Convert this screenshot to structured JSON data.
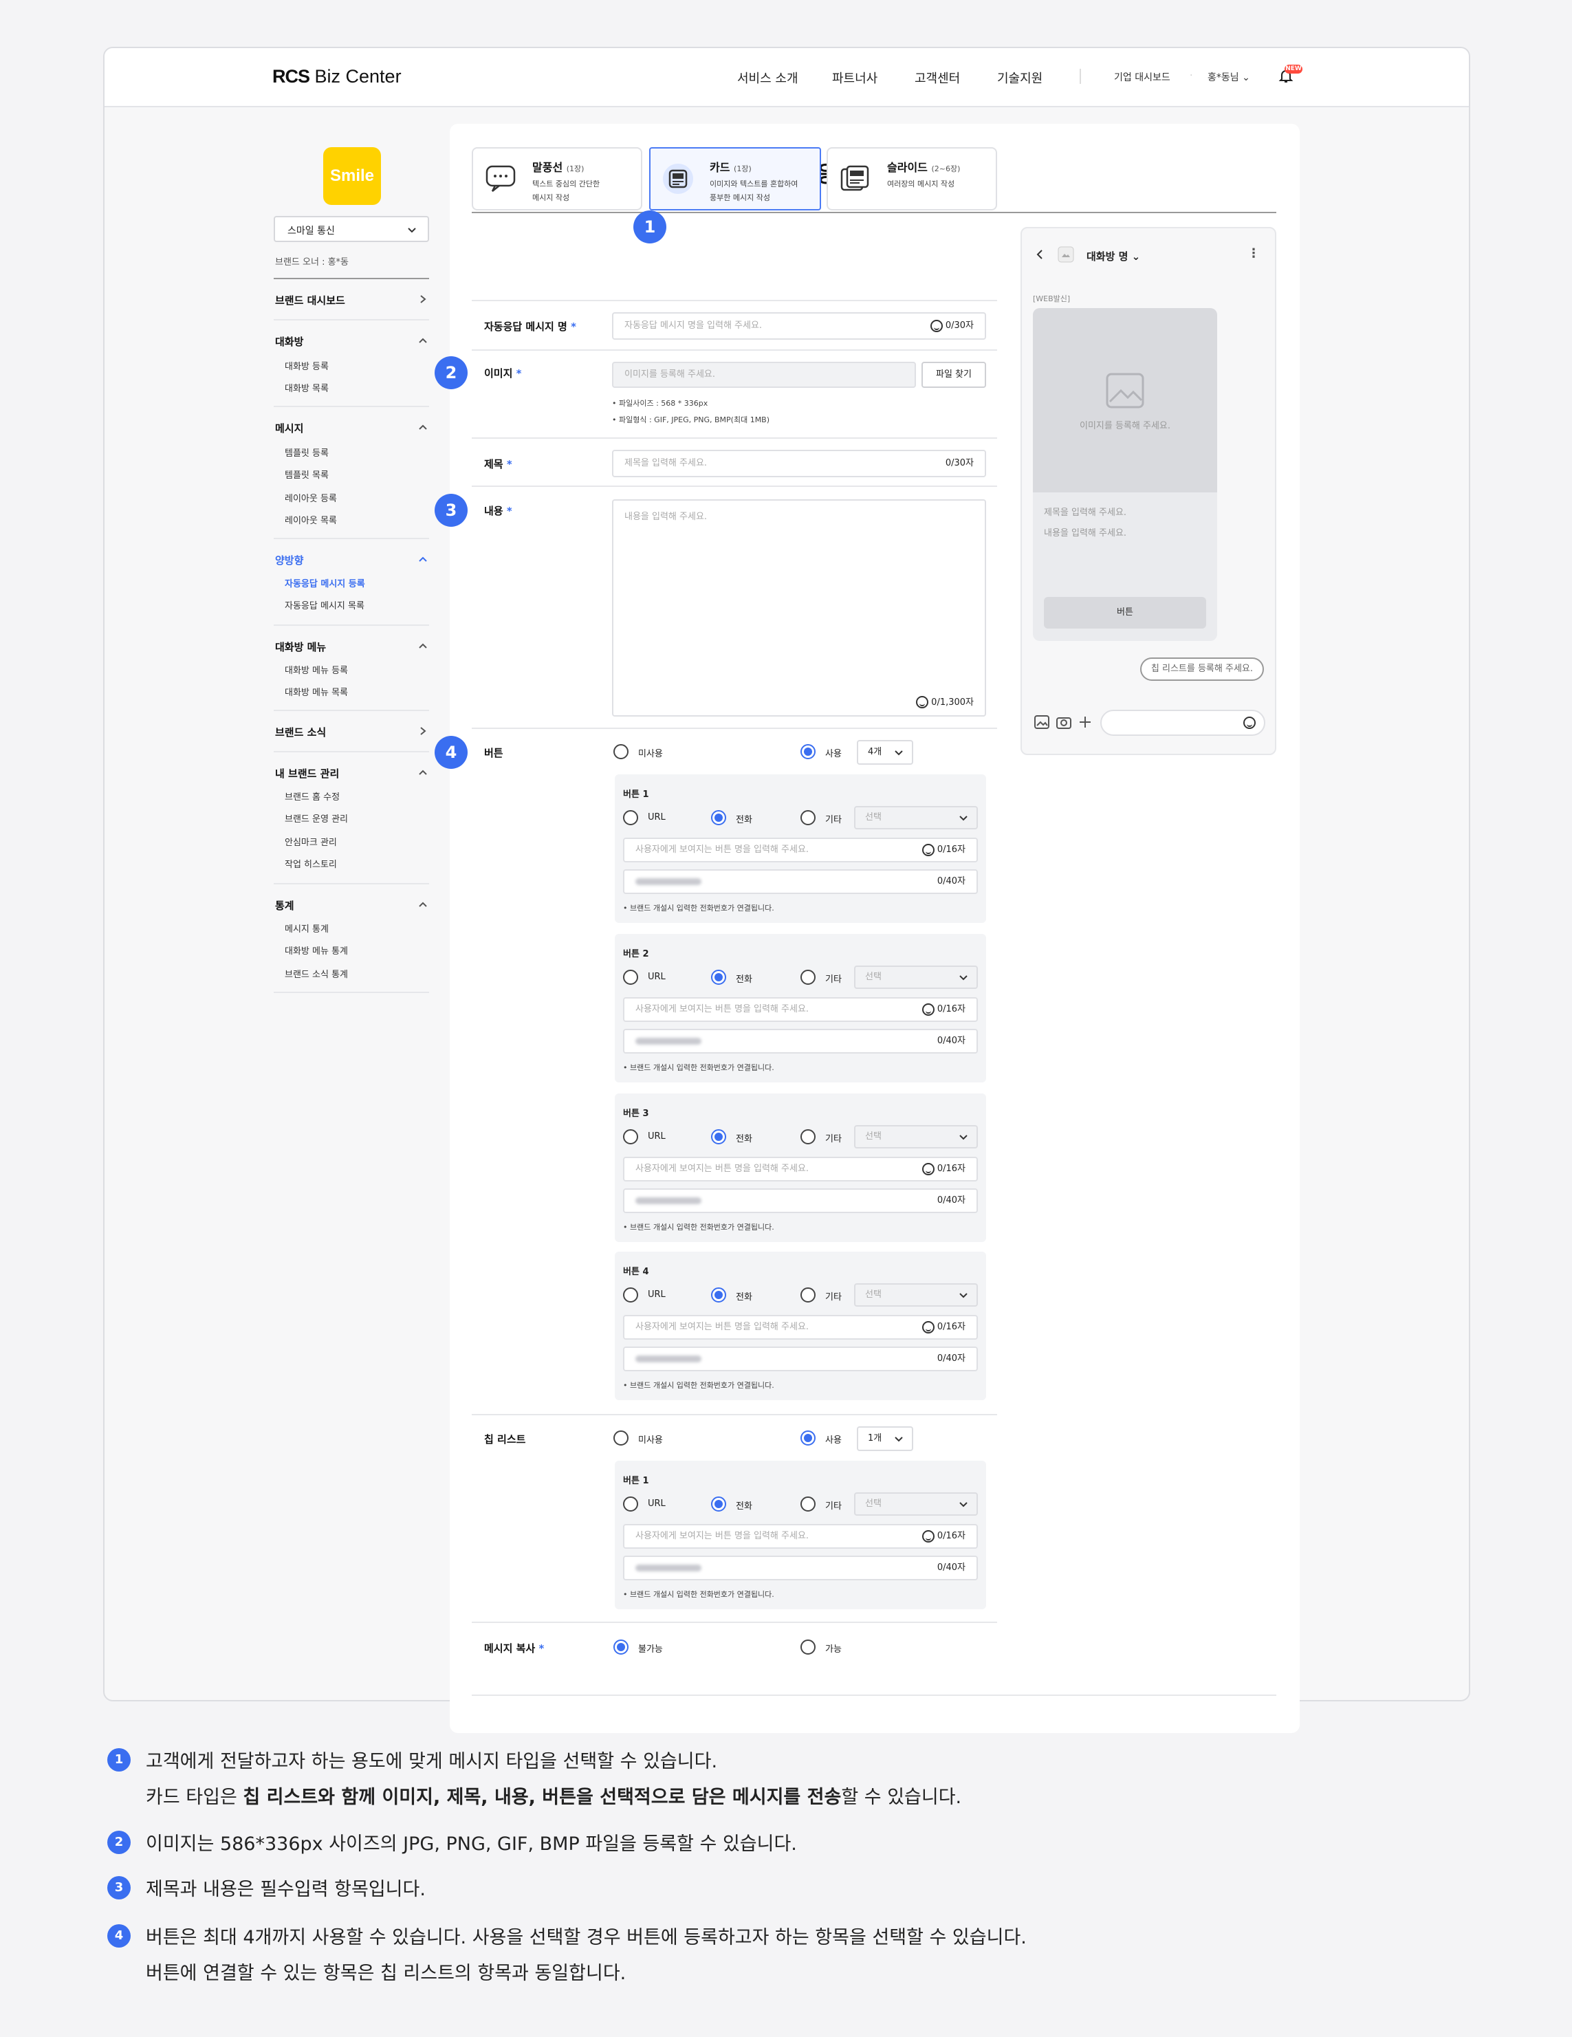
{
  "header": {
    "logo_bold": "RCS",
    "logo_rest": " Biz Center",
    "nav": [
      "서비스 소개",
      "파트너사",
      "고객센터",
      "기술지원"
    ],
    "util": {
      "dashboard": "기업 대시보드",
      "user": "홍*동님",
      "notif_badge": "NEW"
    }
  },
  "sidebar": {
    "brand_logo": "Smile",
    "brand_select": "스마일 통신",
    "owner": "브랜드 오너 : 홍*동",
    "dashboard": "브랜드 대시보드",
    "groups": [
      {
        "title": "대화방",
        "items": [
          "대화방 등록",
          "대화방 목록"
        ]
      },
      {
        "title": "메시지",
        "items": [
          "템플릿 등록",
          "템플릿 목록",
          "레이아웃 등록",
          "레이아웃 목록"
        ]
      },
      {
        "title": "양방향",
        "items": [
          "자동응답 메시지 등록",
          "자동응답 메시지 목록"
        ]
      },
      {
        "title": "대화방 메뉴",
        "items": [
          "대화방 메뉴 등록",
          "대화방 메뉴 목록"
        ]
      },
      {
        "title": "브랜드 소식",
        "items": []
      },
      {
        "title": "내 브랜드 관리",
        "items": [
          "브랜드 홈 수정",
          "브랜드 운영 관리",
          "안심마크 관리",
          "작업 히스토리"
        ]
      },
      {
        "title": "통계",
        "items": [
          "메시지 통계",
          "대화방 메뉴 통계",
          "브랜드 소식 통계"
        ]
      }
    ]
  },
  "page": {
    "title": "자동응답 메시지 등록"
  },
  "tabs": [
    {
      "name": "말풍선",
      "count": "(1장)",
      "desc1": "텍스트 중심의 간단한",
      "desc2": "메시지 작성",
      "icon": "speech-bubble-icon"
    },
    {
      "name": "카드",
      "count": "(1장)",
      "desc1": "이미지와 텍스트를 혼합하여",
      "desc2": "풍부한 메시지 작성",
      "icon": "card-icon"
    },
    {
      "name": "슬라이드",
      "count": "(2~6장)",
      "desc1": "여러장의 메시지 작성",
      "desc2": "",
      "icon": "slide-icon"
    }
  ],
  "form": {
    "name_label": "자동응답 메시지 명",
    "name_placeholder": "자동응답 메시지 명을 입력해 주세요.",
    "name_count": "0/30자",
    "image_label": "이미지",
    "image_placeholder": "이미지를 등록해 주세요.",
    "file_button": "파일 찾기",
    "image_note1": "파일사이즈 : 568 * 336px",
    "image_note2": "파일형식 : GIF, JPEG, PNG, BMP(최대 1MB)",
    "title_label": "제목",
    "title_placeholder": "제목을 입력해 주세요.",
    "title_count": "0/30자",
    "content_label": "내용",
    "content_placeholder": "내용을 입력해 주세요.",
    "content_count": "0/1,300자",
    "button_label": "버튼",
    "unused": "미사용",
    "used": "사용",
    "button_count": "4개",
    "buttons": [
      {
        "title": "버튼 1",
        "url": "URL",
        "phone": "전화",
        "etc": "기타",
        "select": "선택",
        "name_ph": "사용자에게 보여지는 버튼 명을 입력해 주세요.",
        "name_count": "0/16자",
        "phone_count": "0/40자",
        "note": "브랜드 개설시 입력한 전화번호가 연결됩니다."
      },
      {
        "title": "버튼 2",
        "url": "URL",
        "phone": "전화",
        "etc": "기타",
        "select": "선택",
        "name_ph": "사용자에게 보여지는 버튼 명을 입력해 주세요.",
        "name_count": "0/16자",
        "phone_count": "0/40자",
        "note": "브랜드 개설시 입력한 전화번호가 연결됩니다."
      },
      {
        "title": "버튼 3",
        "url": "URL",
        "phone": "전화",
        "etc": "기타",
        "select": "선택",
        "name_ph": "사용자에게 보여지는 버튼 명을 입력해 주세요.",
        "name_count": "0/16자",
        "phone_count": "0/40자",
        "note": "브랜드 개설시 입력한 전화번호가 연결됩니다."
      },
      {
        "title": "버튼 4",
        "url": "URL",
        "phone": "전화",
        "etc": "기타",
        "select": "선택",
        "name_ph": "사용자에게 보여지는 버튼 명을 입력해 주세요.",
        "name_count": "0/16자",
        "phone_count": "0/40자",
        "note": "브랜드 개설시 입력한 전화번호가 연결됩니다."
      }
    ],
    "chip_label": "칩 리스트",
    "chip_count": "1개",
    "chip_button": {
      "title": "버튼 1",
      "url": "URL",
      "phone": "전화",
      "etc": "기타",
      "select": "선택",
      "name_ph": "사용자에게 보여지는 버튼 명을 입력해 주세요.",
      "name_count": "0/16자",
      "phone_count": "0/40자",
      "note": "브랜드 개설시 입력한 전화번호가 연결됩니다."
    },
    "copy_label": "메시지 복사",
    "copy_no": "불가능",
    "copy_yes": "가능"
  },
  "preview": {
    "room": "대화방 명",
    "tag": "[WEB발신]",
    "image_ph": "이미지를 등록해 주세요.",
    "title_ph": "제목을 입력해 주세요.",
    "content_ph": "내용을 입력해 주세요.",
    "button": "버튼",
    "chip_ph": "칩 리스트를 등록해 주세요."
  },
  "legend": [
    {
      "n": "1",
      "l1": "고객에게 전달하고자 하는 용도에 맞게 메시지 타입을 선택할 수 있습니다.",
      "l2a": "카드 타입은 ",
      "l2b": "칩 리스트와 함께 이미지, 제목, 내용, 버튼을 선택적으로 담은 메시지를 전송",
      "l2c": "할 수 있습니다."
    },
    {
      "n": "2",
      "l1": "이미지는 586*336px 사이즈의 JPG, PNG, GIF, BMP 파일을 등록할 수 있습니다."
    },
    {
      "n": "3",
      "l1": "제목과 내용은 필수입력 항목입니다."
    },
    {
      "n": "4",
      "l1": "버튼은 최대 4개까지 사용할 수 있습니다. 사용을 선택할 경우 버튼에 등록하고자 하는 항목을 선택할 수 있습니다.",
      "l2a": "버튼에 연결할 수 있는 항목은 칩 리스트의 항목과 동일합니다."
    }
  ],
  "colors": {
    "accent": "#3a6ef0",
    "brand": "#ffd200",
    "badge": "#ff4a3d"
  }
}
